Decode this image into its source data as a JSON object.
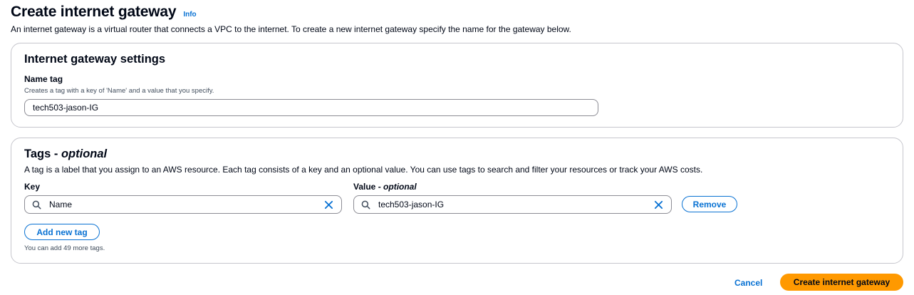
{
  "header": {
    "title": "Create internet gateway",
    "info_label": "Info",
    "description": "An internet gateway is a virtual router that connects a VPC to the internet. To create a new internet gateway specify the name for the gateway below."
  },
  "settings": {
    "title": "Internet gateway settings",
    "name_tag_label": "Name tag",
    "name_tag_description": "Creates a tag with a key of 'Name' and a value that you specify.",
    "name_tag_value": "tech503-jason-IG"
  },
  "tags": {
    "title_main": "Tags - ",
    "title_optional": "optional",
    "description": "A tag is a label that you assign to an AWS resource. Each tag consists of a key and an optional value. You can use tags to search and filter your resources or track your AWS costs.",
    "key_label": "Key",
    "value_label_main": "Value - ",
    "value_label_optional": "optional",
    "rows": [
      {
        "key": "Name",
        "value": "tech503-jason-IG",
        "remove_label": "Remove"
      }
    ],
    "add_label": "Add new tag",
    "hint": "You can add 49 more tags."
  },
  "footer": {
    "cancel_label": "Cancel",
    "submit_label": "Create internet gateway"
  },
  "icons": {
    "search": "search-icon",
    "clear": "close-icon"
  },
  "colors": {
    "link": "#0972d3",
    "primary_button": "#ff9900",
    "text": "#000716",
    "border": "#c6c6cd"
  }
}
